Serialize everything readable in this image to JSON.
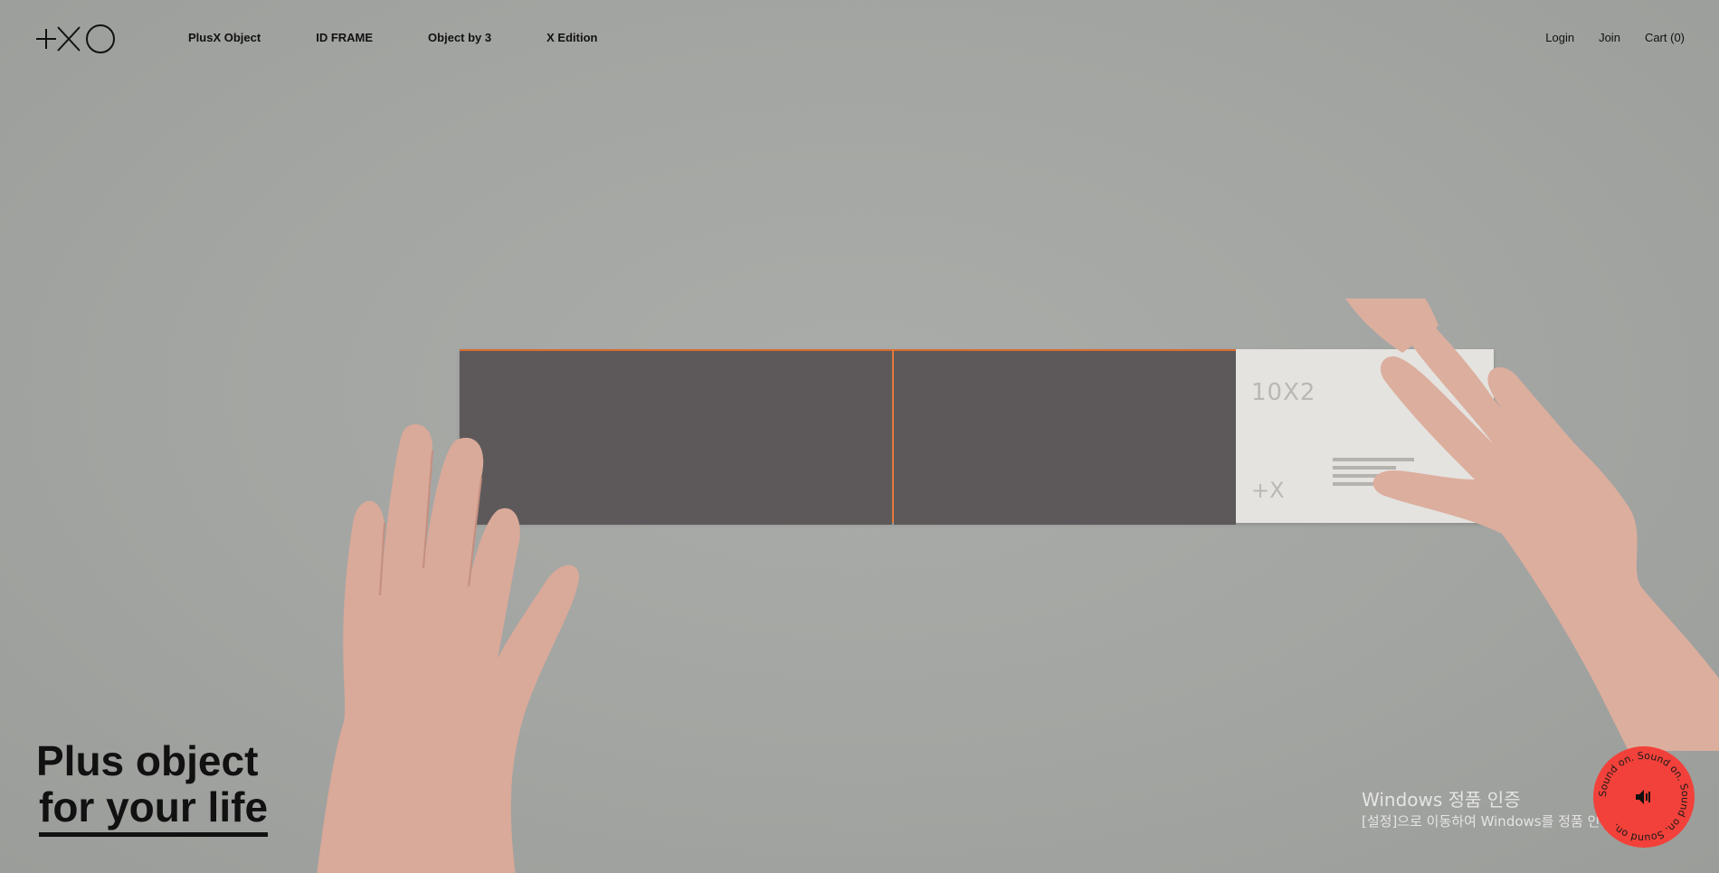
{
  "nav": {
    "logo_alt": "+XO",
    "items": [
      {
        "label": "PlusX Object"
      },
      {
        "label": "ID FRAME"
      },
      {
        "label": "Object by 3"
      },
      {
        "label": "X Edition"
      }
    ]
  },
  "utility": {
    "login": "Login",
    "join": "Join",
    "cart": "Cart (0)"
  },
  "hero": {
    "title_line1": "Plus object",
    "title_line2": "for your life",
    "card_text": "10X2",
    "card_mark": "+X"
  },
  "sound": {
    "ring_text": "Sound on. Sound on. Sound on. Sound on.",
    "icon": "speaker-icon",
    "color": "#f2413a"
  },
  "windows_activation": {
    "title": "Windows 정품 인증",
    "subtitle": "[설정]으로 이동하여 Windows를 정품 인증합니다."
  }
}
